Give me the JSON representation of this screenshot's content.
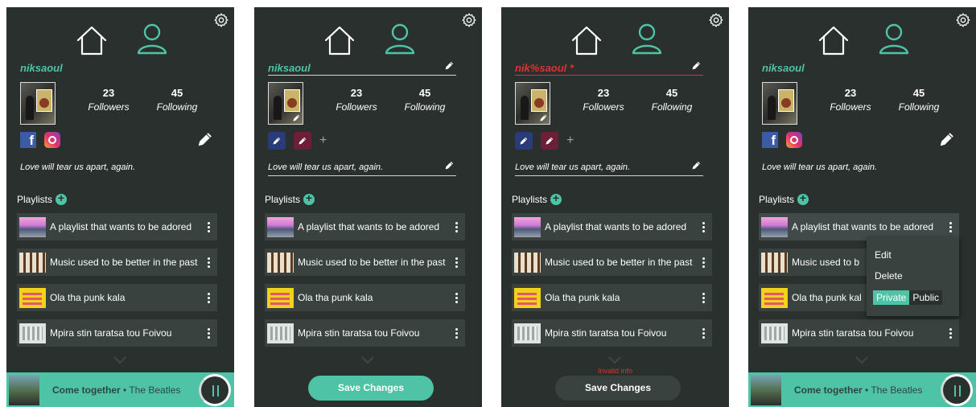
{
  "profile": {
    "username": "niksaoul",
    "username_invalid": "nik%saoul *",
    "followers_count": "23",
    "followers_label": "Followers",
    "following_count": "45",
    "following_label": "Following",
    "bio": "Love will tear us apart, again."
  },
  "playlists": {
    "header": "Playlists",
    "items": [
      {
        "name": "A playlist that wants to be adored"
      },
      {
        "name": "Music used to be better in the past"
      },
      {
        "name": "Ola tha punk kala"
      },
      {
        "name": "Mpira stin taratsa tou Foivou"
      }
    ]
  },
  "menu_row1": {
    "name": "A playlist that wants to be adored"
  },
  "menu_row2": {
    "name": "Music used to b"
  },
  "menu_row3": {
    "name": "Ola tha punk kal"
  },
  "player": {
    "song": "Come together",
    "separator": " • ",
    "artist": "The Beatles"
  },
  "edit": {
    "save_label": "Save Changes",
    "invalid_label": "Invalid info"
  },
  "context_menu": {
    "edit": "Edit",
    "delete": "Delete",
    "private": "Private",
    "public": "Public"
  },
  "colors": {
    "accent": "#4ec3a6",
    "background": "#2a302e",
    "row": "#3a4240",
    "error": "#e03030"
  }
}
